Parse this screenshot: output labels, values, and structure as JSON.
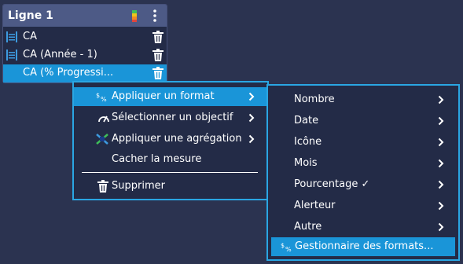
{
  "panel": {
    "title": "Ligne 1",
    "rows": [
      {
        "label": "CA"
      },
      {
        "label": "CA (Année - 1)"
      },
      {
        "label": "CA (% Progressi..."
      }
    ]
  },
  "context_menu": {
    "items": [
      {
        "label": "Appliquer un format",
        "icon": "format-percent-icon"
      },
      {
        "label": "Sélectionner un objectif",
        "icon": "gauge-icon"
      },
      {
        "label": "Appliquer une agrégation",
        "icon": "aggregation-icon"
      },
      {
        "label": "Cacher la mesure"
      },
      {
        "label": "Supprimer",
        "icon": "trash-icon"
      }
    ]
  },
  "format_submenu": {
    "items": [
      {
        "label": "Nombre"
      },
      {
        "label": "Date"
      },
      {
        "label": "Icône"
      },
      {
        "label": "Mois"
      },
      {
        "label": "Pourcentage ✓"
      },
      {
        "label": "Alerteur"
      },
      {
        "label": "Autre"
      },
      {
        "label": "Gestionnaire des formats...",
        "icon": "format-percent-icon"
      }
    ]
  },
  "colors": {
    "background": "#2b3350",
    "panel": "#232b47",
    "header": "#4d5a86",
    "highlight": "#1a95d8",
    "menu_border": "#2aa6e3"
  }
}
